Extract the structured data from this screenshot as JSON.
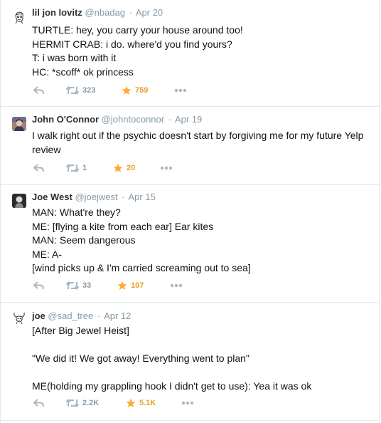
{
  "colors": {
    "star": "#ffac33",
    "muted": "#aab8c2",
    "border": "#e1e8ed"
  },
  "tweets": [
    {
      "name": "lil jon lovitz",
      "handle": "@nbadag",
      "time": "Apr 20",
      "avatar_icon": "sketch-face-icon",
      "text": "TURTLE: hey, you carry your house around too!\nHERMIT CRAB: i do. where'd you find yours?\nT: i was born with it\nHC: *scoff* ok princess",
      "retweets": "323",
      "favorites": "759"
    },
    {
      "name": "John O'Connor",
      "handle": "@johntoconnor",
      "time": "Apr 19",
      "avatar_icon": "profile-photo-icon",
      "text": "I walk right out if the psychic doesn't start by forgiving me for my future Yelp review",
      "retweets": "1",
      "favorites": "20"
    },
    {
      "name": "Joe West",
      "handle": "@joejwest",
      "time": "Apr 15",
      "avatar_icon": "profile-photo-icon",
      "text": "MAN: What're they?\nME: [flying a kite from each ear] Ear kites\nMAN: Seem dangerous\nME: A-\n[wind picks up & I'm carried screaming out to sea]",
      "retweets": "33",
      "favorites": "107"
    },
    {
      "name": "joe",
      "handle": "@sad_tree",
      "time": "Apr 12",
      "avatar_icon": "horned-sketch-icon",
      "text": "[After Big Jewel Heist]\n\n\"We did it! We got away! Everything went to plan\"\n\nME(holding my grappling hook I didn't get to use): Yea it was ok",
      "retweets": "2.2K",
      "favorites": "5.1K"
    }
  ]
}
